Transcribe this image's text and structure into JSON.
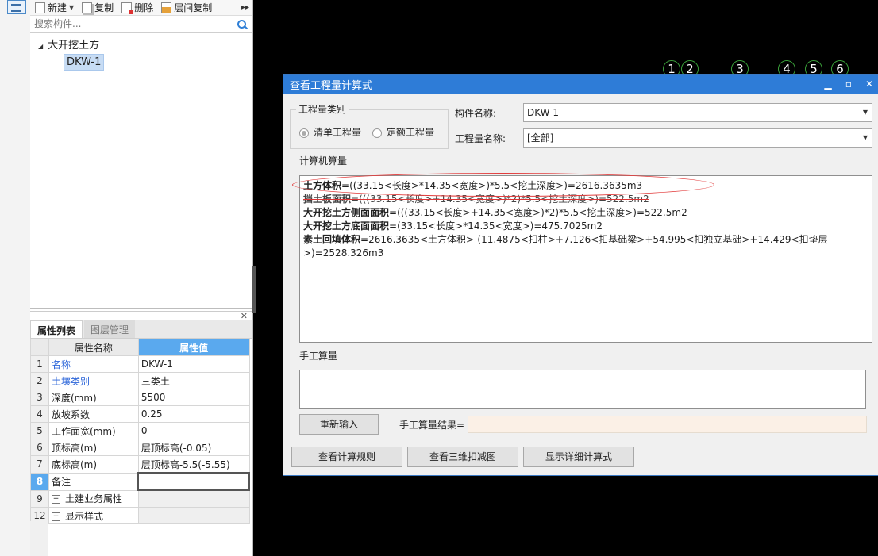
{
  "toolbar": {
    "new_label": "新建",
    "copy_label": "复制",
    "delete_label": "删除",
    "layer_copy_label": "层间复制"
  },
  "search": {
    "placeholder": "搜索构件..."
  },
  "tree": {
    "root_label": "大开挖土方",
    "child_label": "DKW-1"
  },
  "tabs": {
    "properties": "属性列表",
    "layers": "图层管理"
  },
  "props_table": {
    "header_name": "属性名称",
    "header_value": "属性值",
    "rows": [
      {
        "num": "1",
        "name": "名称",
        "value": "DKW-1"
      },
      {
        "num": "2",
        "name": "土壤类别",
        "value": "三类土"
      },
      {
        "num": "3",
        "name": "深度(mm)",
        "value": "5500"
      },
      {
        "num": "4",
        "name": "放坡系数",
        "value": "0.25"
      },
      {
        "num": "5",
        "name": "工作面宽(mm)",
        "value": "0"
      },
      {
        "num": "6",
        "name": "顶标高(m)",
        "value": "层顶标高(-0.05)"
      },
      {
        "num": "7",
        "name": "底标高(m)",
        "value": "层顶标高-5.5(-5.55)"
      },
      {
        "num": "8",
        "name": "备注",
        "value": ""
      },
      {
        "num": "9",
        "name": "土建业务属性",
        "value": ""
      },
      {
        "num": "12",
        "name": "显示样式",
        "value": ""
      }
    ]
  },
  "axes": [
    "1",
    "2",
    "3",
    "4",
    "5",
    "6"
  ],
  "dialog": {
    "title": "查看工程量计算式",
    "category_group": "工程量类别",
    "radio_list": "清单工程量",
    "radio_quota": "定额工程量",
    "component_label": "构件名称:",
    "component_value": "DKW-1",
    "quantity_label": "工程量名称:",
    "quantity_value": "[全部]",
    "calc_section": "计算机算量",
    "calc_lines": [
      {
        "name": "土方体积",
        "formula": "=((33.15<长度>*14.35<宽度>)*5.5<挖土深度>)=2616.3635m3"
      },
      {
        "name": "挡土板面积",
        "formula": "=(((33.15<长度>+14.35<宽度>)*2)*5.5<挖土深度>)=522.5m2"
      },
      {
        "name": "大开挖土方侧面面积",
        "formula": "=(((33.15<长度>+14.35<宽度>)*2)*5.5<挖土深度>)=522.5m2"
      },
      {
        "name": "大开挖土方底面面积",
        "formula": "=(33.15<长度>*14.35<宽度>)=475.7025m2"
      },
      {
        "name": "素土回填体积",
        "formula": "=2616.3635<土方体积>-(11.4875<扣柱>+7.126<扣基础梁>+54.995<扣独立基础>+14.429<扣垫层>)=2528.326m3"
      }
    ],
    "manual_section": "手工算量",
    "reenter_button": "重新输入",
    "manual_result_label": "手工算量结果=",
    "view_rules_button": "查看计算规则",
    "view_3d_button": "查看三维扣减图",
    "show_detail_button": "显示详细计算式"
  }
}
